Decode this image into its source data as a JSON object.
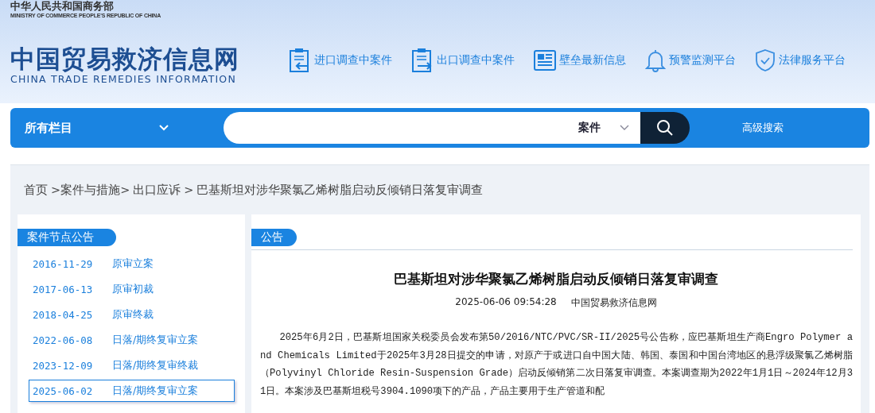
{
  "header": {
    "ministry_cn": "中华人民共和国商务部",
    "ministry_en": "MINISTRY OF COMMERCE PEOPLE'S REPUBLIC OF CHINA",
    "site_cn": "中国贸易救济信息网",
    "site_en": "CHINA TRADE REMEDIES INFORMATION",
    "links": [
      {
        "kind": "import",
        "label": "进口调查中案件"
      },
      {
        "kind": "export",
        "label": "出口调查中案件"
      },
      {
        "kind": "news",
        "label": "壁垒最新信息"
      },
      {
        "kind": "bell",
        "label": "预警监测平台"
      },
      {
        "kind": "shield",
        "label": "法律服务平台"
      }
    ]
  },
  "search_bar": {
    "category": "所有栏目",
    "scope": "案件",
    "advanced": "高级搜索"
  },
  "breadcrumb": [
    "首页",
    ">案件与措施>",
    "出口应诉",
    ">",
    "巴基斯坦对涉华聚氯乙烯树脂启动反倾销日落复审调查"
  ],
  "sidebar": {
    "title": "案件节点公告",
    "items": [
      {
        "date": "2016-11-29",
        "label": "原审立案",
        "selected": false
      },
      {
        "date": "2017-06-13",
        "label": "原审初裁",
        "selected": false
      },
      {
        "date": "2018-04-25",
        "label": "原审终裁",
        "selected": false
      },
      {
        "date": "2022-06-08",
        "label": "日落/期终复审立案",
        "selected": false
      },
      {
        "date": "2023-12-09",
        "label": "日落/期终复审终裁",
        "selected": false
      },
      {
        "date": "2025-06-02",
        "label": "日落/期终复审立案",
        "selected": true
      }
    ]
  },
  "article": {
    "section": "公告",
    "title": "巴基斯坦对涉华聚氯乙烯树脂启动反倾销日落复审调查",
    "datetime": "2025-06-06 09:54:28",
    "source": "中国贸易救济信息网",
    "body": "2025年6月2日，巴基斯坦国家关税委员会发布第50/2016/NTC/PVC/SR-II/2025号公告称，应巴基斯坦生产商Engro Polymer and Chemicals Limited于2025年3月28日提交的申请，对原产于或进口自中国大陆、韩国、泰国和中国台湾地区的悬浮级聚氯乙烯树脂（Polyvinyl Chloride Resin-Suspension Grade）启动反倾销第二次日落复审调查。本案调查期为2022年1月1日～2024年12月31日。本案涉及巴基斯坦税号3904.1090项下的产品，产品主要用于生产管道和配"
  }
}
